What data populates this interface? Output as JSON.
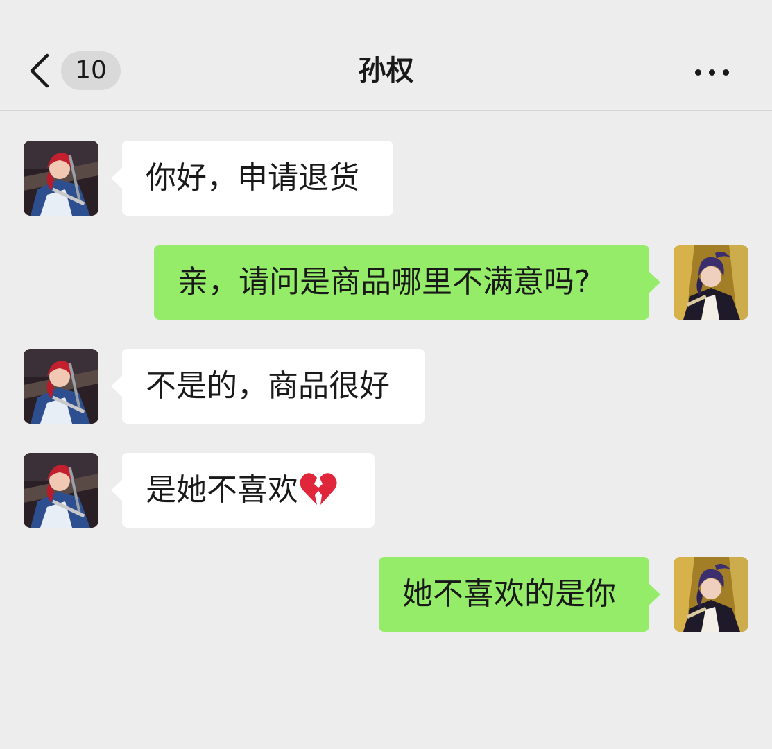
{
  "header": {
    "unread_count": "10",
    "title": "孙权",
    "back_icon": "chevron-left-icon",
    "more_icon": "more-dots-icon"
  },
  "messages": [
    {
      "side": "incoming",
      "text": "你好，申请退货"
    },
    {
      "side": "outgoing",
      "text": "亲，请问是商品哪里不满意吗?"
    },
    {
      "side": "incoming",
      "text": "不是的，商品很好"
    },
    {
      "side": "incoming",
      "text": "是她不喜欢",
      "emoji": "broken-heart-icon"
    },
    {
      "side": "outgoing",
      "text": "她不喜欢的是你"
    }
  ],
  "colors": {
    "background": "#ededed",
    "incoming_bubble": "#ffffff",
    "outgoing_bubble": "#95ec69",
    "emoji_red": "#e0263a"
  }
}
